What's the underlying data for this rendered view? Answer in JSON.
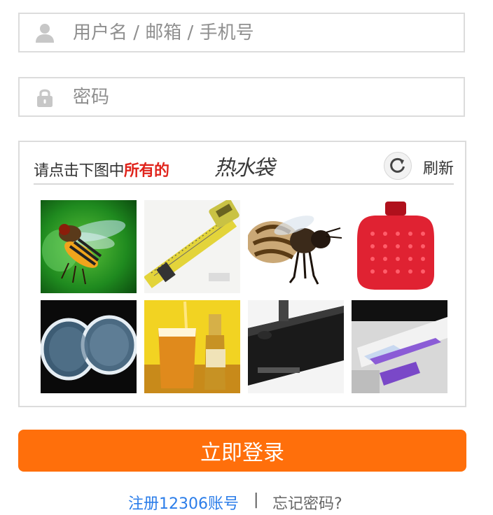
{
  "form": {
    "username_placeholder": "用户名 / 邮箱 / 手机号",
    "username_value": "",
    "password_placeholder": "密码",
    "password_value": ""
  },
  "captcha": {
    "prompt_prefix": "请点击下图中",
    "prompt_highlight": "所有的",
    "target_word": "热水袋",
    "refresh_label": "刷新",
    "images": [
      {
        "subject": "hoverfly"
      },
      {
        "subject": "tape-measure"
      },
      {
        "subject": "bee"
      },
      {
        "subject": "hot-water-bottle"
      },
      {
        "subject": "round-mesh-pads"
      },
      {
        "subject": "beer-glass-and-bottle"
      },
      {
        "subject": "dark-table"
      },
      {
        "subject": "white-purple-device"
      }
    ]
  },
  "login_button_label": "立即登录",
  "links": {
    "register": "注册12306账号",
    "separator": "|",
    "forgot": "忘记密码?"
  },
  "colors": {
    "accent": "#ff6f0b",
    "link": "#2b7de9",
    "highlight": "#e0241c",
    "border": "#dcdcdc"
  }
}
